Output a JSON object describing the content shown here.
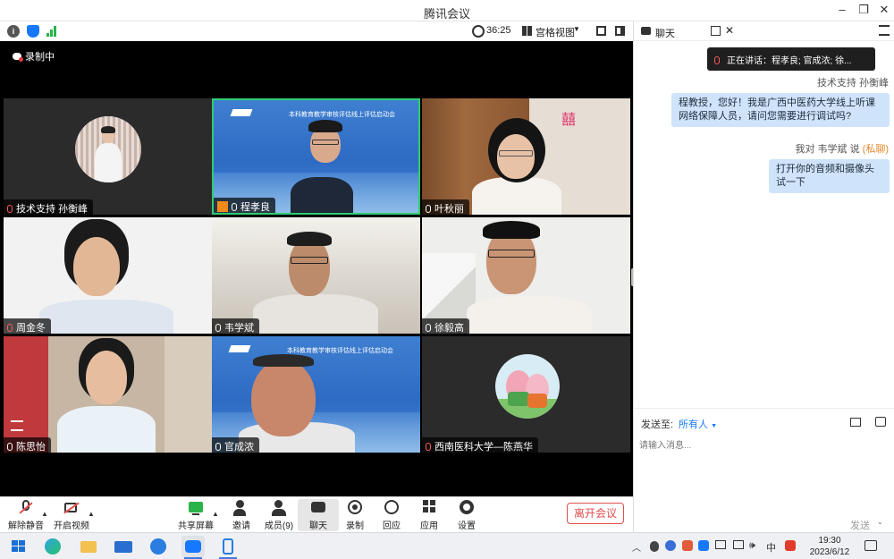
{
  "window": {
    "title": "腾讯会议"
  },
  "topbar": {
    "timer": "36:25",
    "view_label": "宫格视图"
  },
  "recording": {
    "label": "录制中"
  },
  "tiles": [
    {
      "name": "技术支持 孙衡峰"
    },
    {
      "name": "程孝良"
    },
    {
      "name": "叶秋丽"
    },
    {
      "name": "周金冬"
    },
    {
      "name": "韦学斌"
    },
    {
      "name": "徐毅高"
    },
    {
      "name": "陈思怡"
    },
    {
      "name": "官成浓"
    },
    {
      "name": "西南医科大学—陈燕华"
    }
  ],
  "slide": {
    "header": "本科教育教学审核评估线上评估启动会"
  },
  "toolbar": {
    "unmute": "解除静音",
    "video": "开启视频",
    "share": "共享屏幕",
    "invite": "邀请",
    "members": "成员(9)",
    "chat": "聊天",
    "record": "录制",
    "replay": "回应",
    "apps": "应用",
    "settings": "设置",
    "leave": "离开会议"
  },
  "chat": {
    "title": "聊天",
    "speaking": "正在讲话：程孝良; 官成浓; 徐...",
    "sender1": "技术支持 孙衡峰",
    "msg1": "程教授，您好！我是广西中医药大学线上听课网络保障人员，请问您需要进行调试吗?",
    "sender2_prefix": "我对 韦学斌 说",
    "sender2_private": "(私聊)",
    "msg2": "打开你的音频和摄像头试一下",
    "send_to_label": "发送至:",
    "send_to_value": "所有人",
    "input_placeholder": "请输入消息...",
    "send_button": "发送"
  },
  "taskbar": {
    "ime": "中",
    "time": "19:30",
    "date": "2023/6/12"
  },
  "colors": {
    "accent": "#1677ff",
    "leave": "#e34d4d",
    "speaking_border": "#2ecc71"
  }
}
